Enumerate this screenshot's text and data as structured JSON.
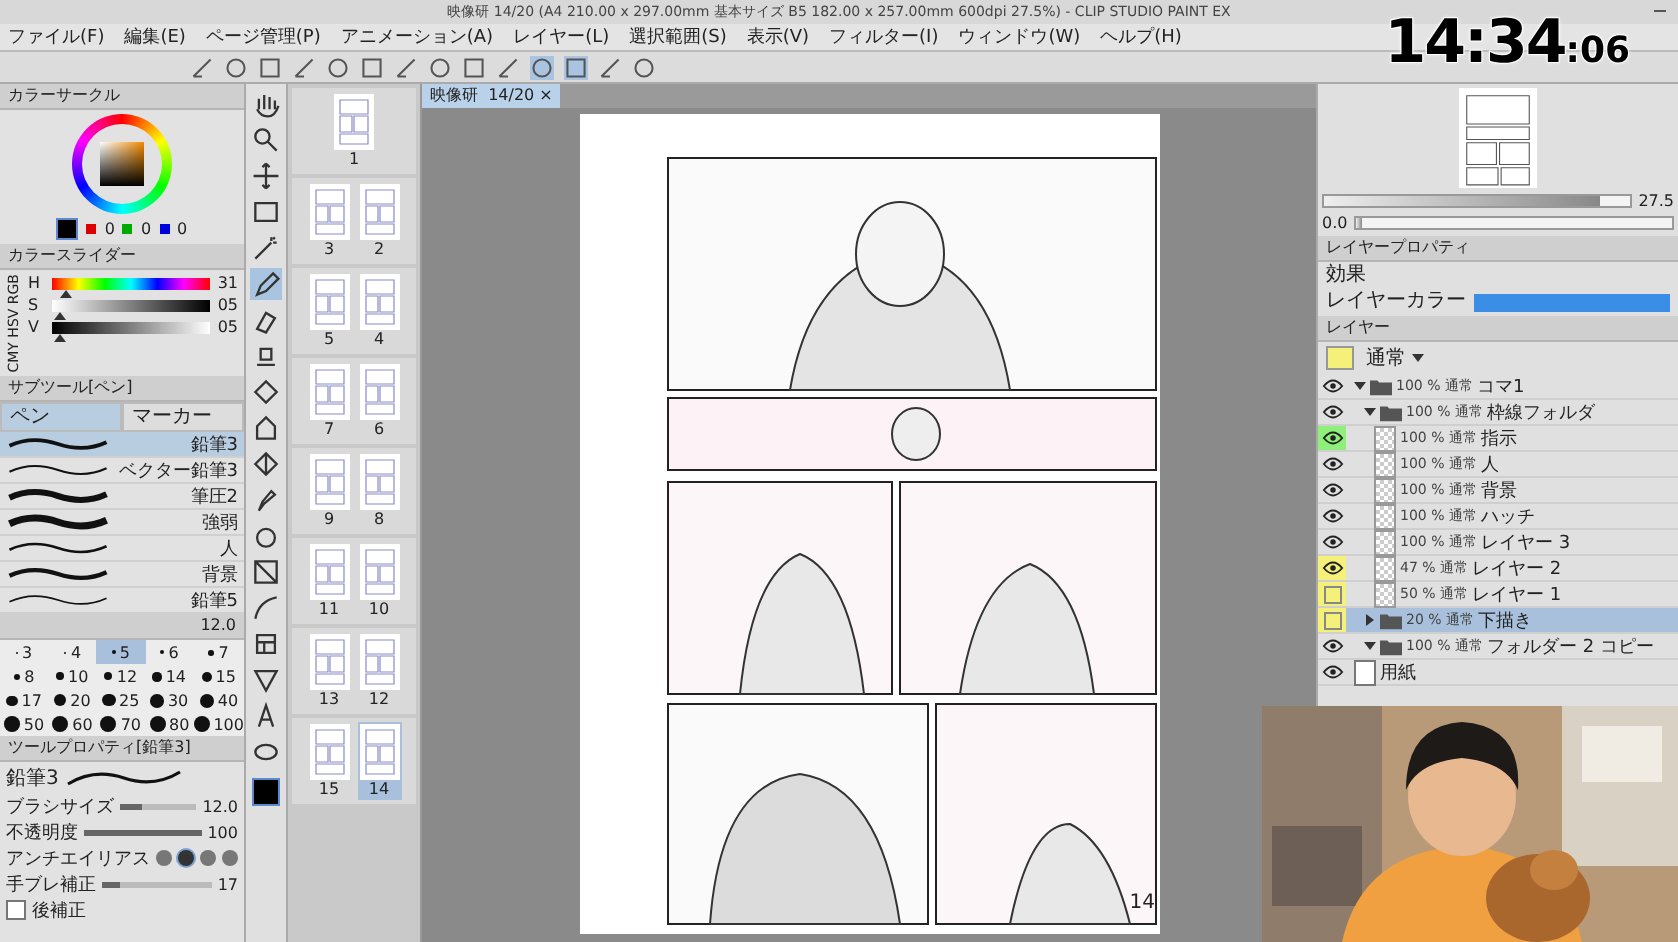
{
  "window": {
    "title": "映像研 14/20 (A4 210.00 x 297.00mm 基本サイズ B5 182.00 x 257.00mm 600dpi 27.5%) - CLIP STUDIO PAINT EX"
  },
  "menu": [
    "ファイル(F)",
    "編集(E)",
    "ページ管理(P)",
    "アニメーション(A)",
    "レイヤー(L)",
    "選択範囲(S)",
    "表示(V)",
    "フィルター(I)",
    "ウィンドウ(W)",
    "ヘルプ(H)"
  ],
  "clock": {
    "time": "14:34",
    "seconds": ":06"
  },
  "color_circle": {
    "tab": "カラーサークル",
    "rgb": [
      "0",
      "0",
      "0"
    ]
  },
  "color_slider": {
    "tab": "カラースライダー",
    "modes": "CMY HSV RGB",
    "sliders": [
      {
        "kind": "hue",
        "label": "H",
        "value": "31",
        "level": 0.09
      },
      {
        "kind": "sat",
        "label": "S",
        "value": "05",
        "level": 0.05
      },
      {
        "kind": "val",
        "label": "V",
        "value": "05",
        "level": 0.05
      }
    ]
  },
  "subtool": {
    "title": "サブツール[ペン]",
    "tabs": [
      {
        "label": "ペン",
        "selected": true
      },
      {
        "label": "マーカー",
        "selected": false
      }
    ],
    "brushes": [
      {
        "name": "鉛筆3",
        "selected": true
      },
      {
        "name": "ベクター鉛筆3",
        "selected": false
      },
      {
        "name": "筆圧2",
        "selected": false
      },
      {
        "name": "強弱",
        "selected": false
      },
      {
        "name": "人",
        "selected": false
      },
      {
        "name": "背景",
        "selected": false
      },
      {
        "name": "鉛筆5",
        "selected": false
      }
    ]
  },
  "brush_size": {
    "value": "12.0",
    "sizes": [
      {
        "label": "3",
        "selected": false
      },
      {
        "label": "4",
        "selected": false
      },
      {
        "label": "5",
        "selected": true
      },
      {
        "label": "6",
        "selected": false
      },
      {
        "label": "7",
        "selected": false
      },
      {
        "label": "8",
        "selected": false
      },
      {
        "label": "10",
        "selected": false
      },
      {
        "label": "12",
        "selected": false
      },
      {
        "label": "14",
        "selected": false
      },
      {
        "label": "15",
        "selected": false
      },
      {
        "label": "17",
        "selected": false
      },
      {
        "label": "20",
        "selected": false
      },
      {
        "label": "25",
        "selected": false
      },
      {
        "label": "30",
        "selected": false
      },
      {
        "label": "40",
        "selected": false
      },
      {
        "label": "50",
        "selected": false
      },
      {
        "label": "60",
        "selected": false
      },
      {
        "label": "70",
        "selected": false
      },
      {
        "label": "80",
        "selected": false
      },
      {
        "label": "100",
        "selected": false
      }
    ]
  },
  "tool_property": {
    "title": "ツールプロパティ[鉛筆3]",
    "brush": "鉛筆3",
    "rows": [
      {
        "kind": "slider",
        "label": "ブラシサイズ",
        "value": "12.0",
        "level": 0.3
      },
      {
        "kind": "slider",
        "label": "不透明度",
        "value": "100",
        "level": 1
      },
      {
        "kind": "dots",
        "label": "アンチエイリアス",
        "options": [
          {
            "selected": false
          },
          {
            "selected": true
          },
          {
            "selected": false
          },
          {
            "selected": false
          }
        ]
      },
      {
        "kind": "slider",
        "label": "手ブレ補正",
        "value": "17",
        "level": 0.17
      },
      {
        "kind": "check",
        "label": "後補正",
        "checked": false
      }
    ]
  },
  "tools": [
    {
      "selected": false
    },
    {
      "selected": false
    },
    {
      "selected": false
    },
    {
      "selected": false
    },
    {
      "selected": false
    },
    {
      "selected": true
    },
    {
      "selected": false
    },
    {
      "selected": false
    },
    {
      "selected": false
    },
    {
      "selected": false
    },
    {
      "selected": false
    },
    {
      "selected": false
    },
    {
      "selected": false
    },
    {
      "selected": false
    },
    {
      "selected": false
    },
    {
      "selected": false
    },
    {
      "selected": false
    },
    {
      "selected": false
    },
    {
      "selected": false
    }
  ],
  "spreads": [
    {
      "pages": [
        {
          "label": "1",
          "selected": false
        }
      ]
    },
    {
      "pages": [
        {
          "label": "3",
          "selected": false
        },
        {
          "label": "2",
          "selected": false
        }
      ]
    },
    {
      "pages": [
        {
          "label": "5",
          "selected": false
        },
        {
          "label": "4",
          "selected": false
        }
      ]
    },
    {
      "pages": [
        {
          "label": "7",
          "selected": false
        },
        {
          "label": "6",
          "selected": false
        }
      ]
    },
    {
      "pages": [
        {
          "label": "9",
          "selected": false
        },
        {
          "label": "8",
          "selected": false
        }
      ]
    },
    {
      "pages": [
        {
          "label": "11",
          "selected": false
        },
        {
          "label": "10",
          "selected": false
        }
      ]
    },
    {
      "pages": [
        {
          "label": "13",
          "selected": false
        },
        {
          "label": "12",
          "selected": false
        }
      ]
    },
    {
      "pages": [
        {
          "label": "15",
          "selected": false
        },
        {
          "label": "14",
          "selected": true
        }
      ]
    }
  ],
  "canvas_tab": {
    "title": "映像研",
    "page": "14/20",
    "close": "×"
  },
  "page": {
    "number": "14"
  },
  "navigator": {
    "zoom": "27.5",
    "zoom_slider": {
      "level": 0.9
    },
    "angle": "0.0",
    "angle_slider": {
      "level": 0.02
    }
  },
  "layer_property": {
    "title": "レイヤープロパティ",
    "effect": "効果",
    "color_label": "レイヤーカラー"
  },
  "layers": {
    "title": "レイヤー",
    "blend": "通常",
    "items": [
      {
        "kind": "folder",
        "opacity": "100 % 通常",
        "name": "コマ1",
        "visible": true,
        "selected": false,
        "expanded": true,
        "children": [
          {
            "kind": "folder",
            "opacity": "100 % 通常",
            "name": "枠線フォルダ",
            "visible": true,
            "selected": false,
            "expanded": true,
            "children": [
              {
                "opacity": "100 % 通常",
                "name": "指示",
                "visible": true,
                "selected": false,
                "color": "#8ef07a"
              },
              {
                "opacity": "100 % 通常",
                "name": "人",
                "visible": true,
                "selected": false
              },
              {
                "opacity": "100 % 通常",
                "name": "背景",
                "visible": true,
                "selected": false
              },
              {
                "opacity": "100 % 通常",
                "name": "ハッチ",
                "visible": true,
                "selected": false
              },
              {
                "opacity": "100 % 通常",
                "name": "レイヤー 3",
                "visible": true,
                "selected": false
              },
              {
                "opacity": "47 % 通常",
                "name": "レイヤー 2",
                "visible": true,
                "selected": false,
                "color": "#f5f07a"
              },
              {
                "opacity": "50 % 通常",
                "name": "レイヤー 1",
                "visible": false,
                "selected": false,
                "color": "#f5f07a"
              }
            ]
          },
          {
            "kind": "folder",
            "opacity": "20 % 通常",
            "name": "下描き",
            "visible": false,
            "selected": true,
            "expanded": false,
            "color": "#f5f07a"
          },
          {
            "kind": "folder",
            "opacity": "100 % 通常",
            "name": "フォルダー 2 コピー",
            "visible": true,
            "selected": false,
            "expanded": true
          }
        ]
      },
      {
        "kind": "paper",
        "name": "用紙",
        "visible": true,
        "selected": false
      }
    ]
  }
}
